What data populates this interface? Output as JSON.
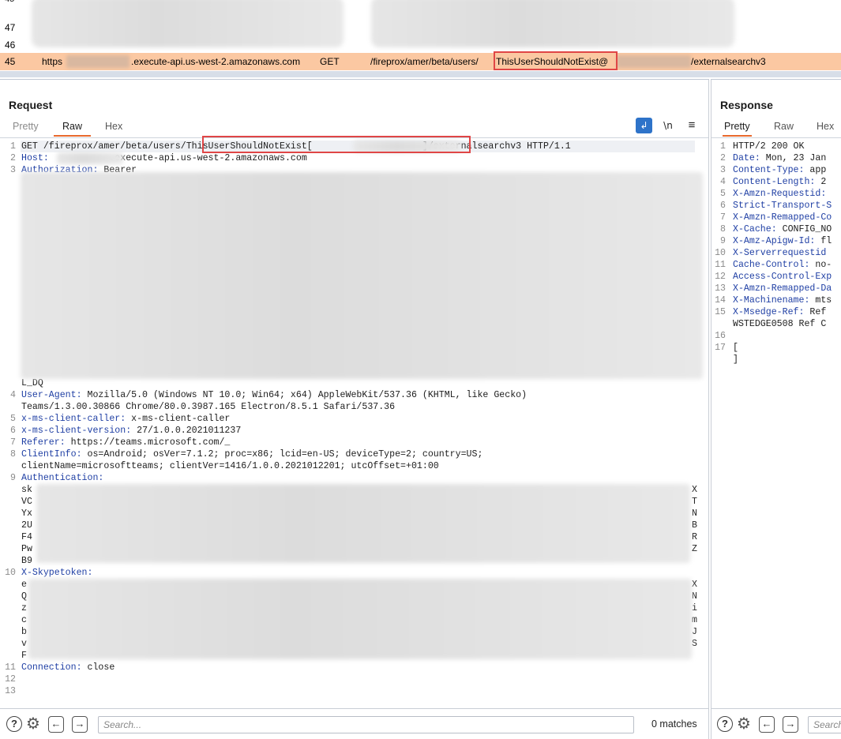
{
  "history": {
    "rows": [
      {
        "num": "45"
      },
      {
        "num": "46"
      },
      {
        "num": "47"
      }
    ],
    "selected": {
      "num": "45",
      "scheme": "https",
      "host_suffix": ".execute-api.us-west-2.amazonaws.com",
      "method": "GET",
      "path_prefix": "/fireprox/amer/beta/users/",
      "path_highlight": "ThisUserShouldNotExist@",
      "path_suffix": "/externalsearchv3"
    }
  },
  "request": {
    "title": "Request",
    "tabs": [
      {
        "label": "Pretty"
      },
      {
        "label": "Raw"
      },
      {
        "label": "Hex"
      }
    ],
    "newline_label": "\\n",
    "lines": [
      {
        "num": "1",
        "text": "GET /fireprox/amer/beta/users/ThisUserShouldNotExist[                    ]/externalsearchv3 HTTP/1.1"
      },
      {
        "num": "2",
        "name": "Host:",
        "value": "           .execute-api.us-west-2.amazonaws.com"
      },
      {
        "num": "3",
        "name": "Authorization:",
        "value": " Bearer"
      },
      {
        "num": "",
        "text": "L_DQ"
      },
      {
        "num": "4",
        "name": "User-Agent:",
        "value": " Mozilla/5.0 (Windows NT 10.0; Win64; x64) AppleWebKit/537.36 (KHTML, like Gecko)"
      },
      {
        "num": "",
        "text": "Teams/1.3.00.30866 Chrome/80.0.3987.165 Electron/8.5.1 Safari/537.36"
      },
      {
        "num": "5",
        "name": "x-ms-client-caller:",
        "value": " x-ms-client-caller"
      },
      {
        "num": "6",
        "name": "x-ms-client-version:",
        "value": " 27/1.0.0.2021011237"
      },
      {
        "num": "7",
        "name": "Referer:",
        "value": " https://teams.microsoft.com/_"
      },
      {
        "num": "8",
        "name": "ClientInfo:",
        "value": " os=Android; osVer=7.1.2; proc=x86; lcid=en-US; deviceType=2; country=US;"
      },
      {
        "num": "",
        "text": "clientName=microsoftteams; clientVer=1416/1.0.0.2021012201; utcOffset=+01:00"
      },
      {
        "num": "9",
        "name": "Authentication:",
        "value": ""
      },
      {
        "num": "",
        "text": "sk",
        "tail": "X"
      },
      {
        "num": "",
        "text": "VC",
        "tail": "T"
      },
      {
        "num": "",
        "text": "Yx",
        "tail": "N"
      },
      {
        "num": "",
        "text": "2U",
        "tail": "B"
      },
      {
        "num": "",
        "text": "F4",
        "tail": "R"
      },
      {
        "num": "",
        "text": "Pw",
        "tail": "Z"
      },
      {
        "num": "",
        "text": "B9"
      },
      {
        "num": "10",
        "name": "X-Skypetoken:",
        "value": ""
      },
      {
        "num": "",
        "text": "e",
        "tail": "X"
      },
      {
        "num": "",
        "text": "Q",
        "tail": "N"
      },
      {
        "num": "",
        "text": "z",
        "tail": "i"
      },
      {
        "num": "",
        "text": "c",
        "tail": "m"
      },
      {
        "num": "",
        "text": "b",
        "tail": "J"
      },
      {
        "num": "",
        "text": "v",
        "tail": "S"
      },
      {
        "num": "",
        "text": "F"
      },
      {
        "num": "11",
        "name": "Connection:",
        "value": " close"
      },
      {
        "num": "12",
        "text": ""
      },
      {
        "num": "13",
        "text": ""
      }
    ],
    "search_placeholder": "Search...",
    "matches": "0 matches"
  },
  "response": {
    "title": "Response",
    "tabs": [
      {
        "label": "Pretty"
      },
      {
        "label": "Raw"
      },
      {
        "label": "Hex"
      }
    ],
    "lines": [
      {
        "num": "1",
        "text": "HTTP/2 200 OK"
      },
      {
        "num": "2",
        "name": "Date:",
        "value": " Mon, 23 Jan"
      },
      {
        "num": "3",
        "name": "Content-Type:",
        "value": " app"
      },
      {
        "num": "4",
        "name": "Content-Length:",
        "value": " 2"
      },
      {
        "num": "5",
        "name": "X-Amzn-Requestid:",
        "value": ""
      },
      {
        "num": "6",
        "name": "Strict-Transport-S",
        "value": ""
      },
      {
        "num": "7",
        "name": "X-Amzn-Remapped-Co",
        "value": ""
      },
      {
        "num": "8",
        "name": "X-Cache:",
        "value": " CONFIG_NO"
      },
      {
        "num": "9",
        "name": "X-Amz-Apigw-Id:",
        "value": " fl"
      },
      {
        "num": "10",
        "name": "X-Serverrequestid",
        "value": ""
      },
      {
        "num": "11",
        "name": "Cache-Control:",
        "value": " no-"
      },
      {
        "num": "12",
        "name": "Access-Control-Exp",
        "value": ""
      },
      {
        "num": "13",
        "name": "X-Amzn-Remapped-Da",
        "value": ""
      },
      {
        "num": "14",
        "name": "X-Machinename:",
        "value": " mts"
      },
      {
        "num": "15",
        "name": "X-Msedge-Ref:",
        "value": " Ref"
      },
      {
        "num": "",
        "text": "WSTEDGE0508 Ref C"
      },
      {
        "num": "16",
        "text": ""
      },
      {
        "num": "17",
        "text": "["
      },
      {
        "num": "",
        "text": "]"
      }
    ],
    "search_placeholder": "Search"
  },
  "icons": {
    "help": "?",
    "prev": "←",
    "next": "→",
    "settings": "⚙"
  },
  "colors": {
    "selected_row": "#fbc8a2",
    "highlight_box": "#e04646",
    "header_name": "#1f3fa4",
    "tab_underline": "#e8692d",
    "wrap_button": "#2e73c9"
  }
}
